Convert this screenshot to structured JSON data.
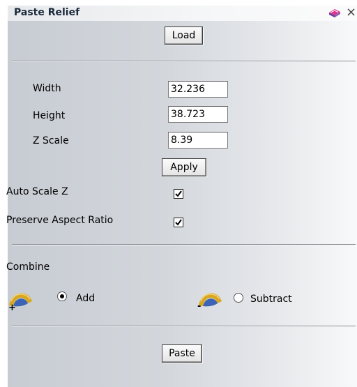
{
  "window": {
    "title": "Paste Relief",
    "close_symbol": "×"
  },
  "load_button": "Load",
  "dimensions": [
    {
      "label": "Width",
      "value": "32.236"
    },
    {
      "label": "Height",
      "value": "38.723"
    },
    {
      "label": "Z Scale",
      "value": "8.39"
    }
  ],
  "apply_button": "Apply",
  "options": {
    "auto_scale_z": {
      "label": "Auto Scale Z",
      "checked": true
    },
    "preserve_aspect_ratio": {
      "label": "Preserve Aspect Ratio",
      "checked": true
    }
  },
  "combine": {
    "heading": "Combine",
    "add": {
      "label": "Add",
      "sign": "+",
      "selected": true
    },
    "subtract": {
      "label": "Subtract",
      "sign": "-",
      "selected": false
    }
  },
  "paste_button": "Paste",
  "colors": {
    "icon_gold": "#d8a722",
    "icon_blue": "#3b63b6",
    "book_pink": "#e0368c",
    "book_purple": "#6a3d9a"
  }
}
